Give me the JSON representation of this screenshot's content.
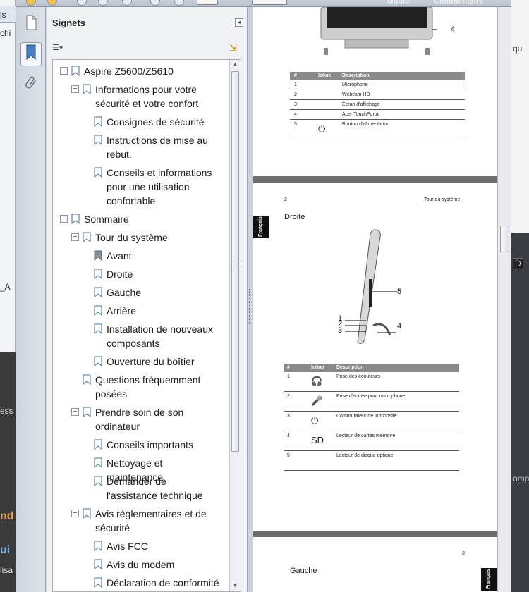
{
  "background": {
    "left_fragments": [
      "ls",
      "chi",
      "_A",
      "ess",
      "nd",
      "ui",
      "lisa"
    ],
    "right_fragments": [
      "qu",
      "D",
      "omp"
    ]
  },
  "toolbar": {
    "page_input": "",
    "zoom_input": "",
    "tools_label": "Outils",
    "comment_label": "Commentaire"
  },
  "rail": {
    "pages_icon": "pages-icon",
    "bookmarks_icon": "bookmark-icon",
    "attachments_icon": "paperclip-icon"
  },
  "panel": {
    "title": "Signets",
    "collapse_symbol": "◂",
    "options_symbol": "☰▾",
    "expand_symbol": "⇲"
  },
  "bookmarks": [
    {
      "label": "Aspire Z5600/Z5610",
      "expanded": true
    },
    {
      "label": "Informations pour votre sécurité et votre confort",
      "expanded": true
    },
    {
      "label": "Consignes de sécurité"
    },
    {
      "label": "Instructions de mise au rebut."
    },
    {
      "label": "Conseils et informations pour une utilisation confortable"
    },
    {
      "label": "Sommaire",
      "expanded": true
    },
    {
      "label": "Tour du système",
      "expanded": true
    },
    {
      "label": "Avant"
    },
    {
      "label": "Droite"
    },
    {
      "label": "Gauche"
    },
    {
      "label": "Arrière"
    },
    {
      "label": "Installation de nouveaux composants"
    },
    {
      "label": "Ouverture du boîtier"
    },
    {
      "label": "Questions fréquemment posées"
    },
    {
      "label": "Prendre soin de son ordinateur",
      "expanded": true
    },
    {
      "label": "Conseils importants"
    },
    {
      "label": "Nettoyage et maintenance"
    },
    {
      "label": "Demander de l'assistance technique"
    },
    {
      "label": "Avis réglementaires et de sécurité",
      "expanded": true
    },
    {
      "label": "Avis FCC"
    },
    {
      "label": "Avis du modem"
    },
    {
      "label": "Déclaration de conformité"
    }
  ],
  "document": {
    "page1": {
      "callout": "4",
      "table": {
        "headers": [
          "#",
          "Icône",
          "Description"
        ],
        "rows": [
          [
            "1",
            "",
            "Microphone"
          ],
          [
            "2",
            "",
            "Webcam HD"
          ],
          [
            "3",
            "",
            "Écran d'affichage"
          ],
          [
            "4",
            "",
            "Acer TouchPortal"
          ],
          [
            "5",
            "⏻",
            "Bouton d'alimentation"
          ]
        ]
      }
    },
    "page2": {
      "page_number": "2",
      "chapter": "Tour du système",
      "lang_tab": "Français",
      "section": "Droite",
      "callouts": [
        "5",
        "1",
        "2",
        "3",
        "4"
      ],
      "table": {
        "headers": [
          "#",
          "Icône",
          "Description"
        ],
        "rows": [
          [
            "1",
            "🎧",
            "Prise des écouteurs"
          ],
          [
            "2",
            "🎤",
            "Prise d'entrée pour microphone"
          ],
          [
            "3",
            "⏻",
            "Commutateur de luminosité"
          ],
          [
            "4",
            "SD",
            "Lecteur de cartes mémoire"
          ],
          [
            "5",
            "",
            "Lecteur de disque optique"
          ]
        ]
      }
    },
    "page3": {
      "page_number": "3",
      "section": "Gauche",
      "lang_tab": "Français"
    }
  }
}
